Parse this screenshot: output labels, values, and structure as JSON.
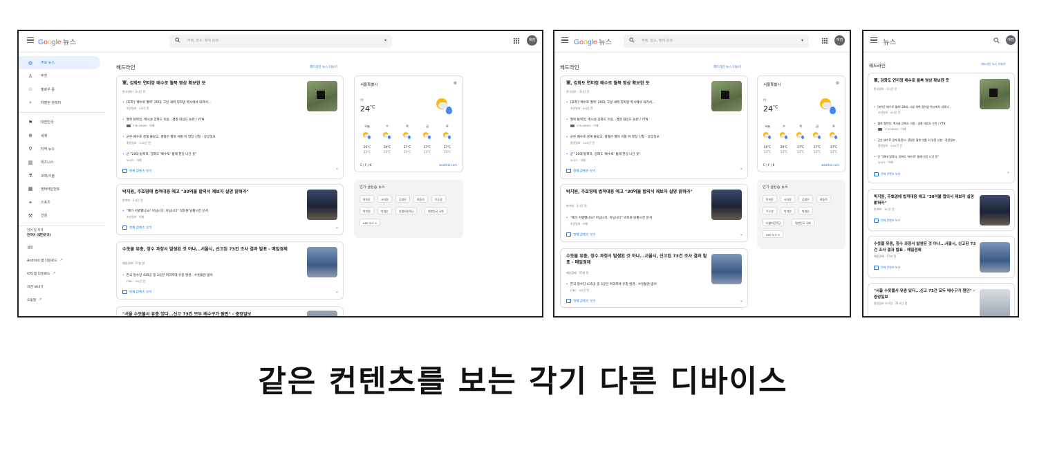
{
  "logo": {
    "google": "Google",
    "news": "뉴스"
  },
  "search_placeholder": "주제, 장소, 매체 검색",
  "avatar_initials": "애점",
  "sidebar": {
    "items": [
      {
        "label": "주요 뉴스",
        "icon": "globe-icon"
      },
      {
        "label": "추천",
        "icon": "person-icon"
      },
      {
        "label": "팔로우 중",
        "icon": "star-icon"
      },
      {
        "label": "저장된 검색어",
        "icon": "search-icon"
      }
    ],
    "sections": [
      {
        "label": "대한민국",
        "icon": "flag-icon"
      },
      {
        "label": "세계",
        "icon": "world-icon"
      },
      {
        "label": "지역 뉴스",
        "icon": "pin-icon"
      },
      {
        "label": "비즈니스",
        "icon": "building-icon"
      },
      {
        "label": "과학/기술",
        "icon": "flask-icon"
      },
      {
        "label": "엔터테인먼트",
        "icon": "film-icon"
      },
      {
        "label": "스포츠",
        "icon": "bike-icon"
      },
      {
        "label": "건강",
        "icon": "wrench-icon"
      }
    ],
    "lang_label": "언어 및 지역",
    "lang_value": "한국어 (대한민국)",
    "footer": [
      {
        "label": "설정",
        "ext": false
      },
      {
        "label": "Android 앱 다운로드",
        "ext": true
      },
      {
        "label": "iOS 앱 다운로드",
        "ext": true
      },
      {
        "label": "의견 보내기",
        "ext": false
      },
      {
        "label": "도움말",
        "ext": true
      }
    ]
  },
  "headlines": {
    "title": "헤드라인",
    "more": "헤드라인 뉴스 더보기"
  },
  "stories": [
    {
      "title": "軍, 강화도 연미정 배수로 월북 영상 확보한 듯",
      "source": "한국일보 · 3시간 전",
      "subs": [
        {
          "text": "[포착] '배수로 월북' 20대, 그날 새벽 정자앞 벽시에서 내려서...",
          "meta": "조선일보 · 4시간 전"
        },
        {
          "text": "월북 탈북민, 백시설 강화도 이용...경찰 대응도 논란 / YTN",
          "meta": "YTN NEWS · 어제"
        },
        {
          "text": "군은 배수로 경계 몰랐고, 경찰은 월북 이틀 뒤 영장 신청 - 중앙일보",
          "meta": "중앙일보 · 14시간 전"
        },
        {
          "text": "군 \"20대 탈북자, 강화도 '배수로' 통해 한강 나간 듯\"",
          "meta": "뉴시스 · 어제"
        }
      ],
      "full": "전체 콘텐츠 보기",
      "chevron": "^"
    },
    {
      "title": "박지원, 주호영에 법적대응 예고 \"30억불 합의서 제보자 실명 밝혀라\"",
      "source": "한겨레 · 1시간 전",
      "subs": [
        {
          "text": "\"제가 서명했나요? 아닙니다, 아닙니다\" 박지원 당황시킨 문서",
          "meta": "조선일보 · 어제"
        }
      ],
      "full": "전체 콘텐츠 보기",
      "chevron": "v"
    },
    {
      "title": "수돗물 유충, 정수 과정서 발생된 것 아냐...서울시, 신고된 73건 조사 결과 발표 - 매일경제",
      "source": "매일경제 · 57분 전",
      "subs": [
        {
          "text": "한국 정수장 435곳 중 3곳만 여과지에 유충 발견...수돗물엔 없어",
          "meta": "JTBC · 4시간 전"
        }
      ],
      "full": "전체 콘텐츠 보기",
      "chevron": "v"
    },
    {
      "title": "\"서울 수돗물서 유충 있다...신고 73건 모두 배수구가 원인\" - 중앙일보",
      "source": "중앙일보 조사팀 · 21시간 전"
    }
  ],
  "weather": {
    "city": "서울특별시",
    "condition": "비",
    "temp": "24",
    "unit": "°C",
    "days": [
      {
        "day": "오늘",
        "hi": "26°C",
        "lo": "23°C"
      },
      {
        "day": "수",
        "hi": "29°C",
        "lo": "23°C"
      },
      {
        "day": "목",
        "hi": "27°C",
        "lo": "23°C"
      },
      {
        "day": "금",
        "hi": "27°C",
        "lo": "23°C"
      },
      {
        "day": "토",
        "hi": "27°C",
        "lo": "23°C"
      }
    ],
    "units": "C | F | K",
    "source": "weather.com"
  },
  "trending": {
    "title": "인기 급상승 뉴스",
    "chips": [
      "박지윤",
      "서지원",
      "김영은",
      "최동석",
      "이소영",
      "박지원",
      "박원순",
      "더불어민주당",
      "대한민국 국회",
      "KBS 뉴스 9"
    ]
  },
  "caption": "같은 컨텐츠를 보는 각기 다른 디바이스"
}
